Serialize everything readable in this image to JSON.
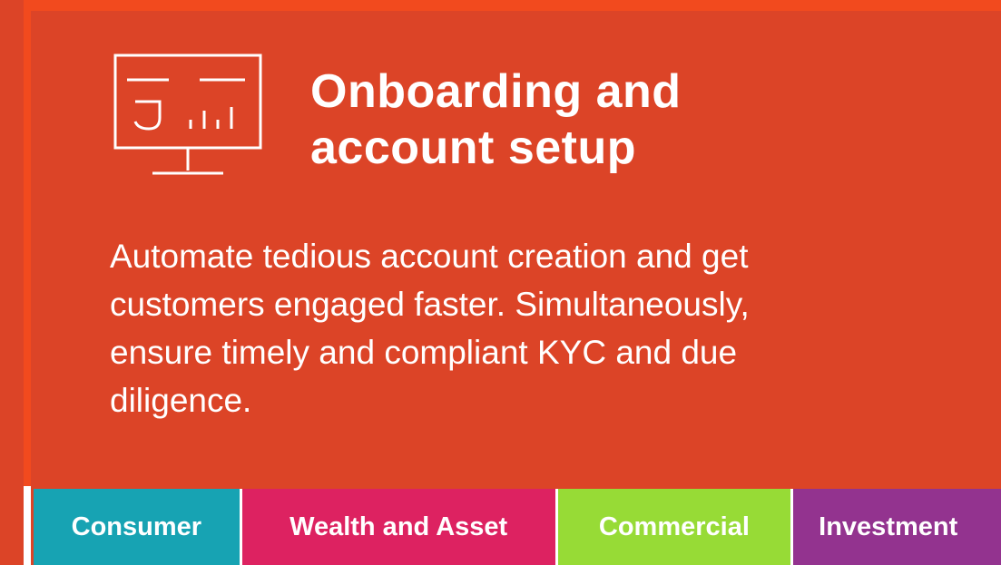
{
  "card": {
    "icon": "monitor-chart-icon",
    "title_lines": [
      "Onboarding and",
      "account setup"
    ],
    "description_lines": [
      "Automate tedious account creation and get",
      "customers engaged faster. Simultaneously,",
      "ensure timely and compliant KYC and due",
      "diligence."
    ],
    "background_color": "#dc4427"
  },
  "tabs": [
    {
      "label": "Consumer",
      "color": "#17a3b3"
    },
    {
      "label": "Wealth and Asset",
      "color": "#dd2261"
    },
    {
      "label": "Commercial",
      "color": "#97db36"
    },
    {
      "label": "Investment",
      "color": "#93338f"
    }
  ],
  "colors": {
    "page_background": "#f24a1e",
    "text": "#ffffff"
  }
}
